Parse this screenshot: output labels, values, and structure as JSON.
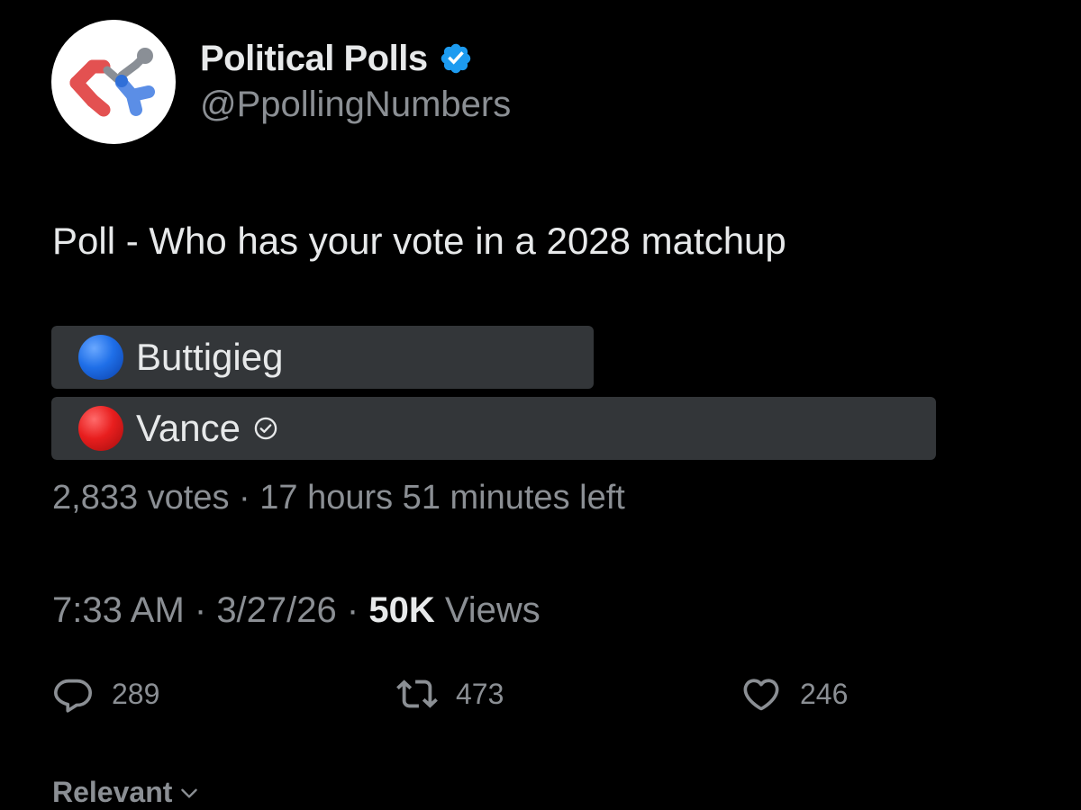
{
  "colors": {
    "background": "#000000",
    "primary_text": "#e7e9ea",
    "secondary_text": "#8b8f94",
    "poll_bar": "#333639",
    "verified_blue": "#1d9bf0"
  },
  "author": {
    "avatar_icon": "molecule-logo-icon",
    "name": "Political Polls",
    "verified_icon": "verified-badge-icon",
    "handle": "@PpollingNumbers"
  },
  "tweet": {
    "text": "Poll - Who has your vote in a 2028 matchup"
  },
  "poll": {
    "options": [
      {
        "label": "Buttigieg",
        "emoji": "blue-circle",
        "share": 0.383,
        "selected": false
      },
      {
        "label": "Vance",
        "emoji": "red-circle",
        "share": 0.617,
        "selected": true,
        "check_icon": "check-circle-icon"
      }
    ],
    "meta": "2,833 votes · 17 hours 51 minutes left"
  },
  "timestamp": {
    "time": "7:33 AM",
    "sep1": " · ",
    "date": "3/27/26",
    "sep2": " · ",
    "views_count": "50K",
    "views_label": " Views"
  },
  "actions": {
    "replies": {
      "icon": "reply-icon",
      "count": "289"
    },
    "reposts": {
      "icon": "repost-icon",
      "count": "473"
    },
    "likes": {
      "icon": "heart-icon",
      "count": "246"
    }
  },
  "sort": {
    "label": "Relevant",
    "icon": "chevron-down-icon"
  }
}
